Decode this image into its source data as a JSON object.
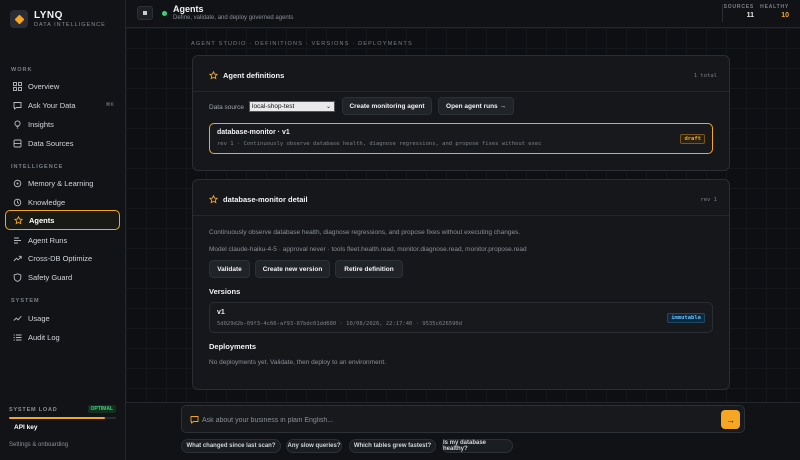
{
  "brand": {
    "name": "LYNQ",
    "subtitle": "DATA INTELLIGENCE"
  },
  "sidebar": {
    "sections": {
      "work": "WORK",
      "intelligence": "INTELLIGENCE",
      "system": "SYSTEM"
    },
    "items": [
      {
        "label": "Overview",
        "icon": "grid-icon"
      },
      {
        "label": "Ask Your Data",
        "icon": "chat-icon",
        "shortcut": "⌘K"
      },
      {
        "label": "Insights",
        "icon": "bulb-icon"
      },
      {
        "label": "Data Sources",
        "icon": "database-icon"
      },
      {
        "label": "Memory & Learning",
        "icon": "memory-icon"
      },
      {
        "label": "Knowledge",
        "icon": "knowledge-icon"
      },
      {
        "label": "Agents",
        "icon": "star-icon",
        "active": true
      },
      {
        "label": "Agent Runs",
        "icon": "runs-icon"
      },
      {
        "label": "Cross-DB Optimize",
        "icon": "trend-icon"
      },
      {
        "label": "Safety Guard",
        "icon": "shield-icon"
      },
      {
        "label": "Usage",
        "icon": "usage-icon"
      },
      {
        "label": "Audit Log",
        "icon": "list-icon"
      }
    ],
    "system_load": {
      "label": "SYSTEM LOAD",
      "status": "OPTIMAL",
      "level": 0.9
    },
    "api_key_label": "API key",
    "settings_link": "Settings & onboarding"
  },
  "topbar": {
    "title": "Agents",
    "subtitle": "Define, validate, and deploy governed agents",
    "stats": [
      {
        "label": "SOURCES",
        "value": "11",
        "color": "#e6e8eb"
      },
      {
        "label": "HEALTHY",
        "value": "10",
        "color": "#f5a623"
      }
    ]
  },
  "main": {
    "breadcrumb": "AGENT STUDIO · DEFINITIONS · VERSIONS · DEPLOYMENTS",
    "definitions_card": {
      "title": "Agent definitions",
      "count": "1 total",
      "data_source_label": "Data source",
      "data_source_value": "local-shop-test",
      "create_button": "Create monitoring agent",
      "open_runs_button": "Open agent runs →",
      "item": {
        "name": "database-monitor · v1",
        "description": "rev 1 · Continuously observe database health, diagnose regressions, and propose fixes without exec",
        "badge": "draft"
      }
    },
    "detail_card": {
      "title": "database-monitor detail",
      "rev": "rev 1",
      "description": "Continuously observe database health, diagnose regressions, and propose fixes without executing changes.",
      "model_line": "Model claude-haiku-4-5 · approval never · tools fleet.health.read, monitor.diagnose.read, monitor.propose.read",
      "buttons": {
        "validate": "Validate",
        "new_version": "Create new version",
        "retire": "Retire definition"
      },
      "versions_heading": "Versions",
      "version": {
        "name": "v1",
        "meta": "5d029d2b-09f3-4c66-af93-87bdc01dd680 · 10/08/2026, 22:17:40 · 9535c626590d",
        "badge": "immutable"
      },
      "deployments_heading": "Deployments",
      "deployments_note": "No deployments yet. Validate, then deploy to an environment."
    }
  },
  "bottom": {
    "ask_placeholder": "Ask about your business in plain English...",
    "send_icon": "→",
    "suggestions": [
      "What changed since last scan?",
      "Any slow queries?",
      "Which tables grew fastest?",
      "Is my database healthy?"
    ]
  },
  "colors": {
    "accent": "#f5a623",
    "healthy": "#3bd07c",
    "immutable": "#5cc0ff"
  }
}
